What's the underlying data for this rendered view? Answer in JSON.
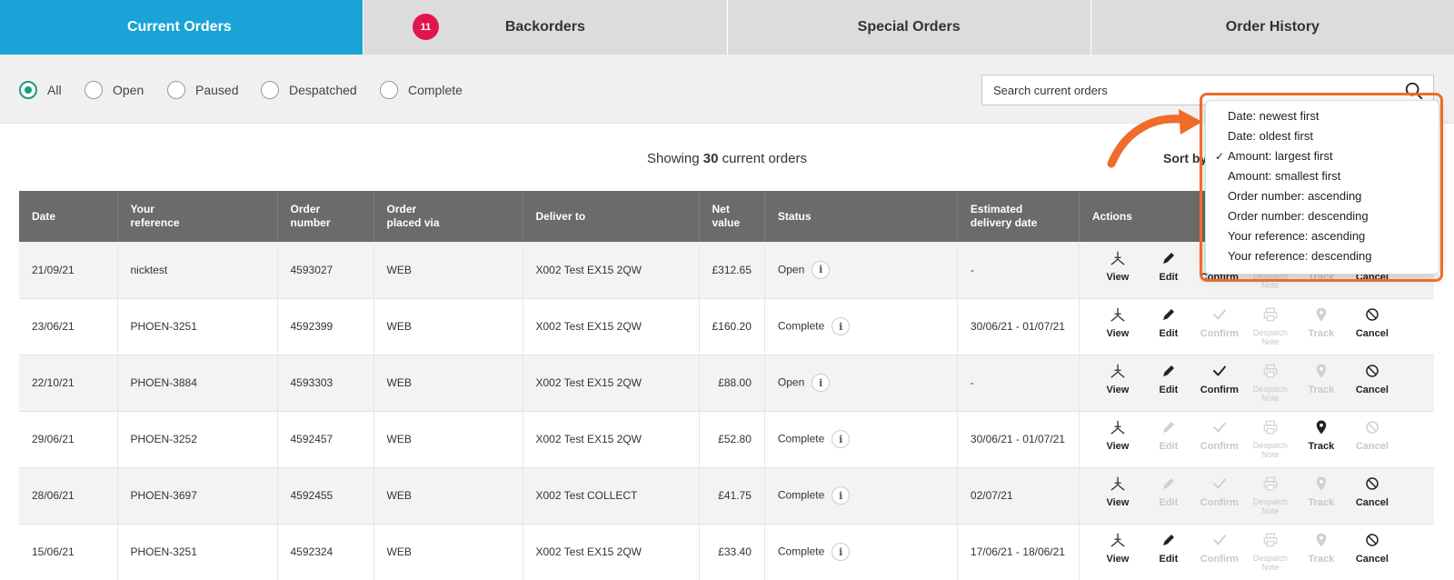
{
  "tabs": [
    {
      "label": "Current Orders",
      "badge": "11",
      "active": true
    },
    {
      "label": "Backorders",
      "active": false
    },
    {
      "label": "Special Orders",
      "active": false
    },
    {
      "label": "Order History",
      "active": false
    }
  ],
  "filters": [
    {
      "label": "All",
      "checked": true
    },
    {
      "label": "Open",
      "checked": false
    },
    {
      "label": "Paused",
      "checked": false
    },
    {
      "label": "Despatched",
      "checked": false
    },
    {
      "label": "Complete",
      "checked": false
    }
  ],
  "search": {
    "placeholder": "Search current orders"
  },
  "summary": {
    "prefix": "Showing",
    "count": "30",
    "suffix": "current orders"
  },
  "sort": {
    "label": "Sort by:",
    "options": [
      {
        "label": "Date: newest first",
        "selected": false
      },
      {
        "label": "Date: oldest first",
        "selected": false
      },
      {
        "label": "Amount: largest first",
        "selected": true
      },
      {
        "label": "Amount: smallest first",
        "selected": false
      },
      {
        "label": "Order number: ascending",
        "selected": false
      },
      {
        "label": "Order number: descending",
        "selected": false
      },
      {
        "label": "Your reference: ascending",
        "selected": false
      },
      {
        "label": "Your reference: descending",
        "selected": false
      }
    ]
  },
  "table": {
    "headers": {
      "date": "Date",
      "ref_1": "Your",
      "ref_2": "reference",
      "order_1": "Order",
      "order_2": "number",
      "via_1": "Order",
      "via_2": "placed via",
      "deliver": "Deliver to",
      "net_1": "Net",
      "net_2": "value",
      "status": "Status",
      "est_1": "Estimated",
      "est_2": "delivery date",
      "actions": "Actions"
    },
    "action_labels": {
      "view": "View",
      "edit": "Edit",
      "confirm": "Confirm",
      "despatch_1": "Despatch",
      "despatch_2": "Note",
      "track": "Track",
      "cancel": "Cancel"
    },
    "info_glyph": "i",
    "rows": [
      {
        "date": "21/09/21",
        "reference": "nicktest",
        "order_number": "4593027",
        "placed_via": "WEB",
        "deliver_to": "X002 Test EX15 2QW",
        "net_value": "£312.65",
        "status": "Open",
        "estimated": "-",
        "edit": true,
        "confirm": true,
        "despatch": false,
        "track": false,
        "cancel": true
      },
      {
        "date": "23/06/21",
        "reference": "PHOEN-3251",
        "order_number": "4592399",
        "placed_via": "WEB",
        "deliver_to": "X002 Test EX15 2QW",
        "net_value": "£160.20",
        "status": "Complete",
        "estimated": "30/06/21 - 01/07/21",
        "edit": true,
        "confirm": false,
        "despatch": false,
        "track": false,
        "cancel": true
      },
      {
        "date": "22/10/21",
        "reference": "PHOEN-3884",
        "order_number": "4593303",
        "placed_via": "WEB",
        "deliver_to": "X002 Test EX15 2QW",
        "net_value": "£88.00",
        "status": "Open",
        "estimated": "-",
        "edit": true,
        "confirm": true,
        "despatch": false,
        "track": false,
        "cancel": true
      },
      {
        "date": "29/06/21",
        "reference": "PHOEN-3252",
        "order_number": "4592457",
        "placed_via": "WEB",
        "deliver_to": "X002 Test EX15 2QW",
        "net_value": "£52.80",
        "status": "Complete",
        "estimated": "30/06/21 - 01/07/21",
        "edit": false,
        "confirm": false,
        "despatch": false,
        "track": true,
        "cancel": false
      },
      {
        "date": "28/06/21",
        "reference": "PHOEN-3697",
        "order_number": "4592455",
        "placed_via": "WEB",
        "deliver_to": "X002 Test COLLECT",
        "net_value": "£41.75",
        "status": "Complete",
        "estimated": "02/07/21",
        "edit": false,
        "confirm": false,
        "despatch": false,
        "track": false,
        "cancel": true
      },
      {
        "date": "15/06/21",
        "reference": "PHOEN-3251",
        "order_number": "4592324",
        "placed_via": "WEB",
        "deliver_to": "X002 Test EX15 2QW",
        "net_value": "£33.40",
        "status": "Complete",
        "estimated": "17/06/21 - 18/06/21",
        "edit": true,
        "confirm": false,
        "despatch": false,
        "track": false,
        "cancel": true
      }
    ]
  },
  "colors": {
    "tab_active": "#1aa3d6",
    "badge": "#e0154f",
    "radio": "#1a9d7d",
    "highlight": "#ef6c2a",
    "header": "#6b6b6b"
  }
}
